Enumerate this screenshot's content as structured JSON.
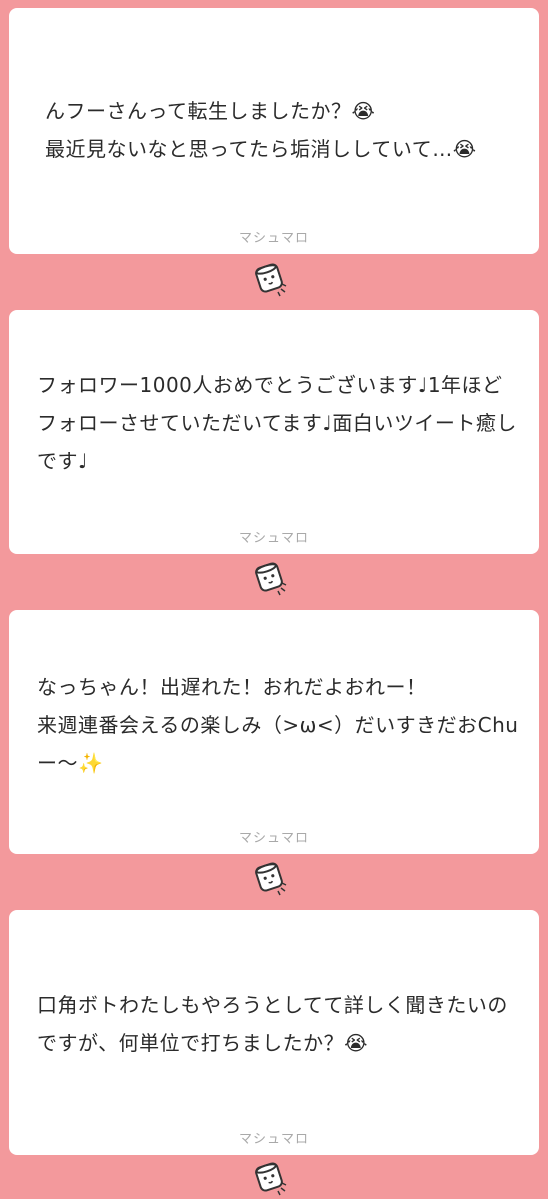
{
  "colors": {
    "background": "#f3999c",
    "card": "#ffffff",
    "text": "#2b2b2b",
    "footer_text": "#a9a9a9"
  },
  "cards": [
    {
      "message": "んフーさんって転生しましたか？😭\n最近見ないなと思ってたら垢消ししていて…😭",
      "footer": "マシュマロ"
    },
    {
      "message": "フォロワー1000人おめでとうございます♩1年ほどフォローさせていただいてます♩面白いツイート癒しです♩",
      "footer": "マシュマロ"
    },
    {
      "message": "なっちゃん！出遅れた！おれだよおれー！\n来週連番会えるの楽しみ（>ω<）だいすきだおChuー〜✨",
      "footer": "マシュマロ"
    },
    {
      "message": "口角ボトわたしもやろうとしてて詳しく聞きたいのですが、何単位で打ちましたか？😭",
      "footer": "マシュマロ"
    }
  ],
  "icons": {
    "mascot": "marshmallow-mascot-icon"
  }
}
